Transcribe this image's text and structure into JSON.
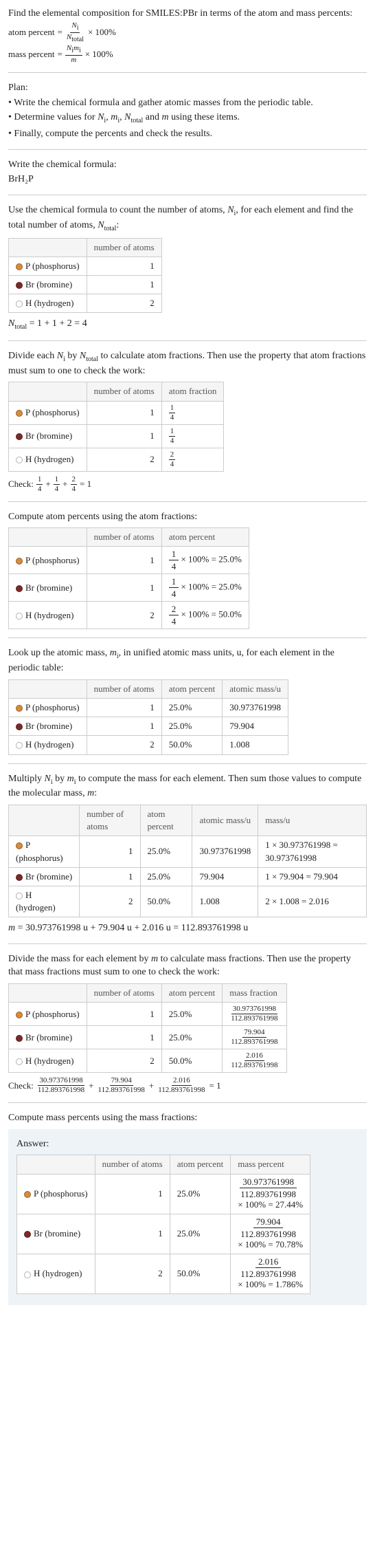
{
  "intro": {
    "line1": "Find the elemental composition for SMILES:PBr in terms of the atom and mass percents:",
    "atom_percent_label": "atom percent",
    "mass_percent_label": "mass percent",
    "eq": "=",
    "times100": "× 100%",
    "frac1_num": "N",
    "frac1_num_sub": "i",
    "frac1_den": "N",
    "frac1_den_sub": "total",
    "frac2_num": "N",
    "frac2_num_sub_i": "i",
    "frac2_num_m": "m",
    "frac2_num_sub_mi": "i",
    "frac2_den": "m"
  },
  "plan": {
    "title": "Plan:",
    "b1": "• Write the chemical formula and gather atomic masses from the periodic table.",
    "b2_a": "• Determine values for ",
    "b2_b": ", ",
    "b2_c": ", ",
    "b2_d": " and ",
    "b2_e": " using these items.",
    "b3": "• Finally, compute the percents and check the results.",
    "Ni": "N",
    "Ni_sub": "i",
    "mi": "m",
    "mi_sub": "i",
    "Ntot": "N",
    "Ntot_sub": "total",
    "m": "m"
  },
  "chemformula": {
    "label": "Write the chemical formula:",
    "value": "BrH₂P"
  },
  "count_atoms": {
    "text_a": "Use the chemical formula to count the number of atoms, ",
    "text_b": ", for each element and find the total number of atoms, ",
    "text_c": ":",
    "Ni": "N",
    "Ni_sub": "i",
    "Ntot": "N",
    "Ntot_sub": "total",
    "hdr_num": "number of atoms",
    "rows": [
      {
        "el": "P (phosphorus)",
        "sw": "sw-p",
        "n": "1"
      },
      {
        "el": "Br (bromine)",
        "sw": "sw-br",
        "n": "1"
      },
      {
        "el": "H (hydrogen)",
        "sw": "sw-h",
        "n": "2"
      }
    ],
    "total_lhs": "N",
    "total_sub": "total",
    "total_eq": " = 1 + 1 + 2 = 4"
  },
  "atom_fractions": {
    "text_a": "Divide each ",
    "text_b": " by ",
    "text_c": " to calculate atom fractions. Then use the property that atom fractions must sum to one to check the work:",
    "Ni": "N",
    "Ni_sub": "i",
    "Ntot": "N",
    "Ntot_sub": "total",
    "hdr_num": "number of atoms",
    "hdr_frac": "atom fraction",
    "rows": [
      {
        "el": "P (phosphorus)",
        "sw": "sw-p",
        "n": "1",
        "fnum": "1",
        "fden": "4"
      },
      {
        "el": "Br (bromine)",
        "sw": "sw-br",
        "n": "1",
        "fnum": "1",
        "fden": "4"
      },
      {
        "el": "H (hydrogen)",
        "sw": "sw-h",
        "n": "2",
        "fnum": "2",
        "fden": "4"
      }
    ],
    "check_label": "Check: ",
    "plus": " + ",
    "eq1": " = 1"
  },
  "atom_percents": {
    "text": "Compute atom percents using the atom fractions:",
    "hdr_num": "number of atoms",
    "hdr_pct": "atom percent",
    "rows": [
      {
        "el": "P (phosphorus)",
        "sw": "sw-p",
        "n": "1",
        "fnum": "1",
        "fden": "4",
        "res": " × 100% = 25.0%"
      },
      {
        "el": "Br (bromine)",
        "sw": "sw-br",
        "n": "1",
        "fnum": "1",
        "fden": "4",
        "res": " × 100% = 25.0%"
      },
      {
        "el": "H (hydrogen)",
        "sw": "sw-h",
        "n": "2",
        "fnum": "2",
        "fden": "4",
        "res": " × 100% = 50.0%"
      }
    ]
  },
  "atomic_mass": {
    "text_a": "Look up the atomic mass, ",
    "text_b": ", in unified atomic mass units, u, for each element in the periodic table:",
    "mi": "m",
    "mi_sub": "i",
    "hdr_num": "number of atoms",
    "hdr_pct": "atom percent",
    "hdr_mass": "atomic mass/u",
    "rows": [
      {
        "el": "P (phosphorus)",
        "sw": "sw-p",
        "n": "1",
        "pct": "25.0%",
        "mass": "30.973761998"
      },
      {
        "el": "Br (bromine)",
        "sw": "sw-br",
        "n": "1",
        "pct": "25.0%",
        "mass": "79.904"
      },
      {
        "el": "H (hydrogen)",
        "sw": "sw-h",
        "n": "2",
        "pct": "50.0%",
        "mass": "1.008"
      }
    ]
  },
  "molecular_mass": {
    "text_a": "Multiply ",
    "text_b": " by ",
    "text_c": " to compute the mass for each element. Then sum those values to compute the molecular mass, ",
    "text_d": ":",
    "Ni": "N",
    "Ni_sub": "i",
    "mi": "m",
    "mi_sub": "i",
    "m": "m",
    "hdr_num": "number of atoms",
    "hdr_pct": "atom percent",
    "hdr_amass": "atomic mass/u",
    "hdr_mass": "mass/u",
    "rows": [
      {
        "el": "P (phosphorus)",
        "sw": "sw-p",
        "n": "1",
        "pct": "25.0%",
        "amass": "30.973761998",
        "calc": "1 × 30.973761998 = 30.973761998"
      },
      {
        "el": "Br (bromine)",
        "sw": "sw-br",
        "n": "1",
        "pct": "25.0%",
        "amass": "79.904",
        "calc": "1 × 79.904 = 79.904"
      },
      {
        "el": "H (hydrogen)",
        "sw": "sw-h",
        "n": "2",
        "pct": "50.0%",
        "amass": "1.008",
        "calc": "2 × 1.008 = 2.016"
      }
    ],
    "total": " = 30.973761998 u + 79.904 u + 2.016 u = 112.893761998 u"
  },
  "mass_fractions": {
    "text_a": "Divide the mass for each element by ",
    "text_b": " to calculate mass fractions. Then use the property that mass fractions must sum to one to check the work:",
    "m": "m",
    "hdr_num": "number of atoms",
    "hdr_pct": "atom percent",
    "hdr_frac": "mass fraction",
    "rows": [
      {
        "el": "P (phosphorus)",
        "sw": "sw-p",
        "n": "1",
        "pct": "25.0%",
        "fnum": "30.973761998",
        "fden": "112.893761998"
      },
      {
        "el": "Br (bromine)",
        "sw": "sw-br",
        "n": "1",
        "pct": "25.0%",
        "fnum": "79.904",
        "fden": "112.893761998"
      },
      {
        "el": "H (hydrogen)",
        "sw": "sw-h",
        "n": "2",
        "pct": "50.0%",
        "fnum": "2.016",
        "fden": "112.893761998"
      }
    ],
    "check_label": "Check: ",
    "plus": " + ",
    "eq1": " = 1"
  },
  "mass_percents": {
    "text": "Compute mass percents using the mass fractions:",
    "answer_label": "Answer:",
    "hdr_num": "number of atoms",
    "hdr_pct": "atom percent",
    "hdr_mpct": "mass percent",
    "rows": [
      {
        "el": "P (phosphorus)",
        "sw": "sw-p",
        "n": "1",
        "pct": "25.0%",
        "fnum": "30.973761998",
        "fden": "112.893761998",
        "res": "× 100% = 27.44%"
      },
      {
        "el": "Br (bromine)",
        "sw": "sw-br",
        "n": "1",
        "pct": "25.0%",
        "fnum": "79.904",
        "fden": "112.893761998",
        "res": "× 100% = 70.78%"
      },
      {
        "el": "H (hydrogen)",
        "sw": "sw-h",
        "n": "2",
        "pct": "50.0%",
        "fnum": "2.016",
        "fden": "112.893761998",
        "res": "× 100% = 1.786%"
      }
    ]
  }
}
